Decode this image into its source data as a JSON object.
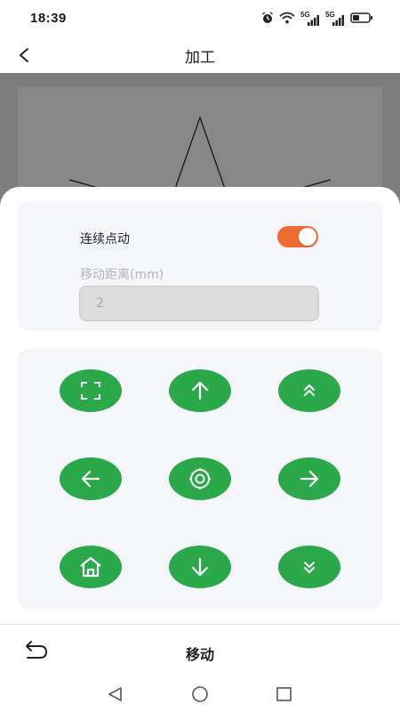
{
  "status_bar": {
    "time": "18:39",
    "icons": [
      "alarm-icon",
      "wifi-icon",
      "signal-5g-icon",
      "signal-5g-icon",
      "battery-icon"
    ],
    "network_labels": [
      "5G",
      "5G"
    ]
  },
  "app_bar": {
    "title": "加工",
    "back_icon": "chevron-left-icon"
  },
  "jog_panel": {
    "continuous_label": "连续点动",
    "continuous_on": true,
    "distance_label": "移动距离(mm)",
    "distance_value": "2"
  },
  "control_pad": {
    "buttons": [
      {
        "name": "frame-button",
        "icon": "frame-corners-icon"
      },
      {
        "name": "move-up-button",
        "icon": "arrow-up-icon"
      },
      {
        "name": "page-up-button",
        "icon": "double-chevron-up-icon"
      },
      {
        "name": "move-left-button",
        "icon": "arrow-left-icon"
      },
      {
        "name": "center-button",
        "icon": "target-icon"
      },
      {
        "name": "move-right-button",
        "icon": "arrow-right-icon"
      },
      {
        "name": "home-button",
        "icon": "home-icon"
      },
      {
        "name": "move-down-button",
        "icon": "arrow-down-icon"
      },
      {
        "name": "page-down-button",
        "icon": "double-chevron-down-icon"
      }
    ]
  },
  "bottom_bar": {
    "label": "移动",
    "undo_icon": "undo-icon"
  },
  "nav_bar": {
    "icons": [
      "nav-back-icon",
      "nav-home-icon",
      "nav-recent-icon"
    ]
  },
  "colors": {
    "accent_green": "#2aa84a",
    "toggle_orange": "#ee6b34",
    "preview_gray": "#7d7d7d",
    "card_bg": "#f5f6fa"
  }
}
